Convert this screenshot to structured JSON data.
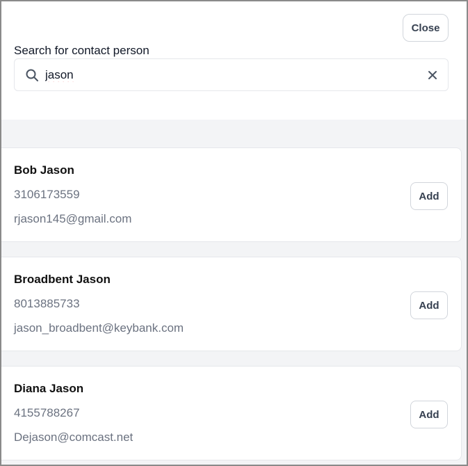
{
  "header": {
    "close_label": "Close",
    "search_label": "Search for contact person",
    "search_value": "jason"
  },
  "icons": {
    "search": "magnifier-icon",
    "clear": "x-icon"
  },
  "colors": {
    "muted_text": "#6b7280",
    "results_bg": "#f3f4f6",
    "spellcheck_underline": "#e02424"
  },
  "contacts": [
    {
      "name": "Bob Jason",
      "phone": "3106173559",
      "email": "rjason145@gmail.com",
      "action": "Add"
    },
    {
      "name": "Broadbent Jason",
      "phone": "8013885733",
      "email": "jason_broadbent@keybank.com",
      "action": "Add"
    },
    {
      "name": "Diana Jason",
      "phone": "4155788267",
      "email": "Dejason@comcast.net",
      "action": "Add"
    }
  ]
}
